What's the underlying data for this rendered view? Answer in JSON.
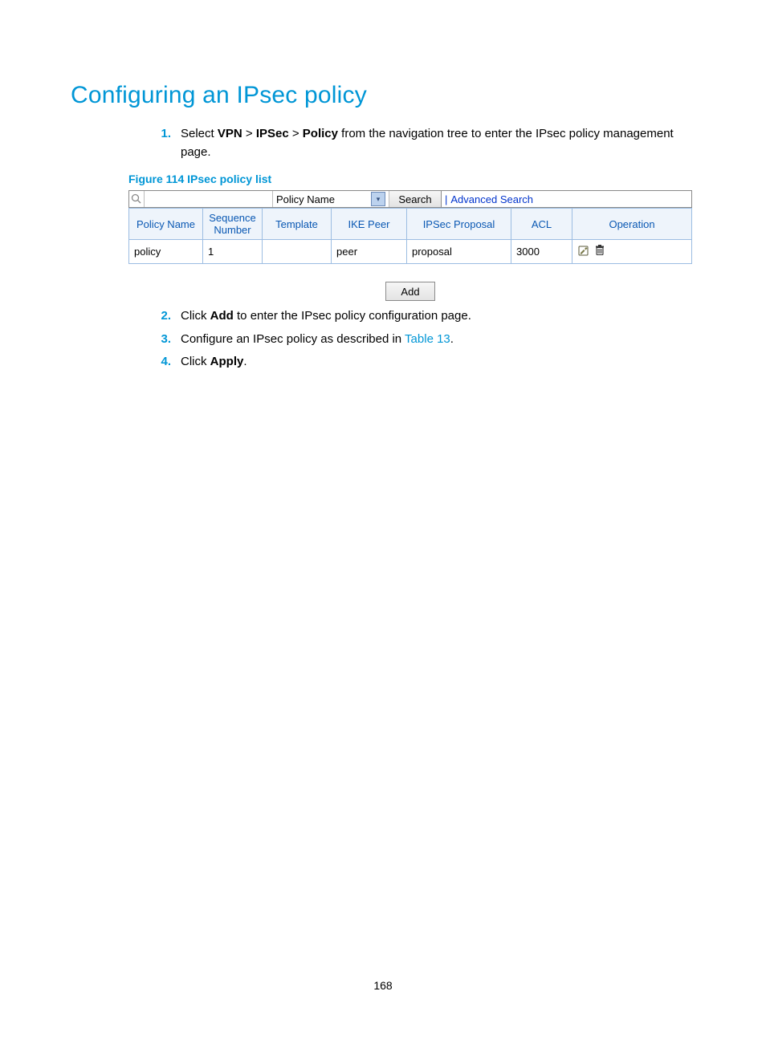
{
  "heading": "Configuring an IPsec policy",
  "steps": {
    "s1": {
      "num": "1.",
      "pre": "Select ",
      "nav1": "VPN",
      "gt1": " > ",
      "nav2": "IPSec",
      "gt2": " > ",
      "nav3": "Policy",
      "post": " from the navigation tree to enter the IPsec policy management page."
    },
    "s2": {
      "num": "2.",
      "pre": "Click ",
      "b": "Add",
      "post": " to enter the IPsec policy configuration page."
    },
    "s3": {
      "num": "3.",
      "pre": "Configure an IPsec policy as described in ",
      "link": "Table 13",
      "post": "."
    },
    "s4": {
      "num": "4.",
      "pre": "Click ",
      "b": "Apply",
      "post": "."
    }
  },
  "figure_caption": "Figure 114 IPsec policy list",
  "search": {
    "select_value": "Policy Name",
    "button": "Search",
    "advanced": "Advanced Search"
  },
  "table": {
    "headers": {
      "policy_name": "Policy Name",
      "sequence_number": "Sequence Number",
      "template": "Template",
      "ike_peer": "IKE Peer",
      "ipsec_proposal": "IPSec Proposal",
      "acl": "ACL",
      "operation": "Operation"
    },
    "rows": [
      {
        "policy_name": "policy",
        "sequence_number": "1",
        "template": "",
        "ike_peer": "peer",
        "ipsec_proposal": "proposal",
        "acl": "3000"
      }
    ]
  },
  "add_button": "Add",
  "page_number": "168"
}
